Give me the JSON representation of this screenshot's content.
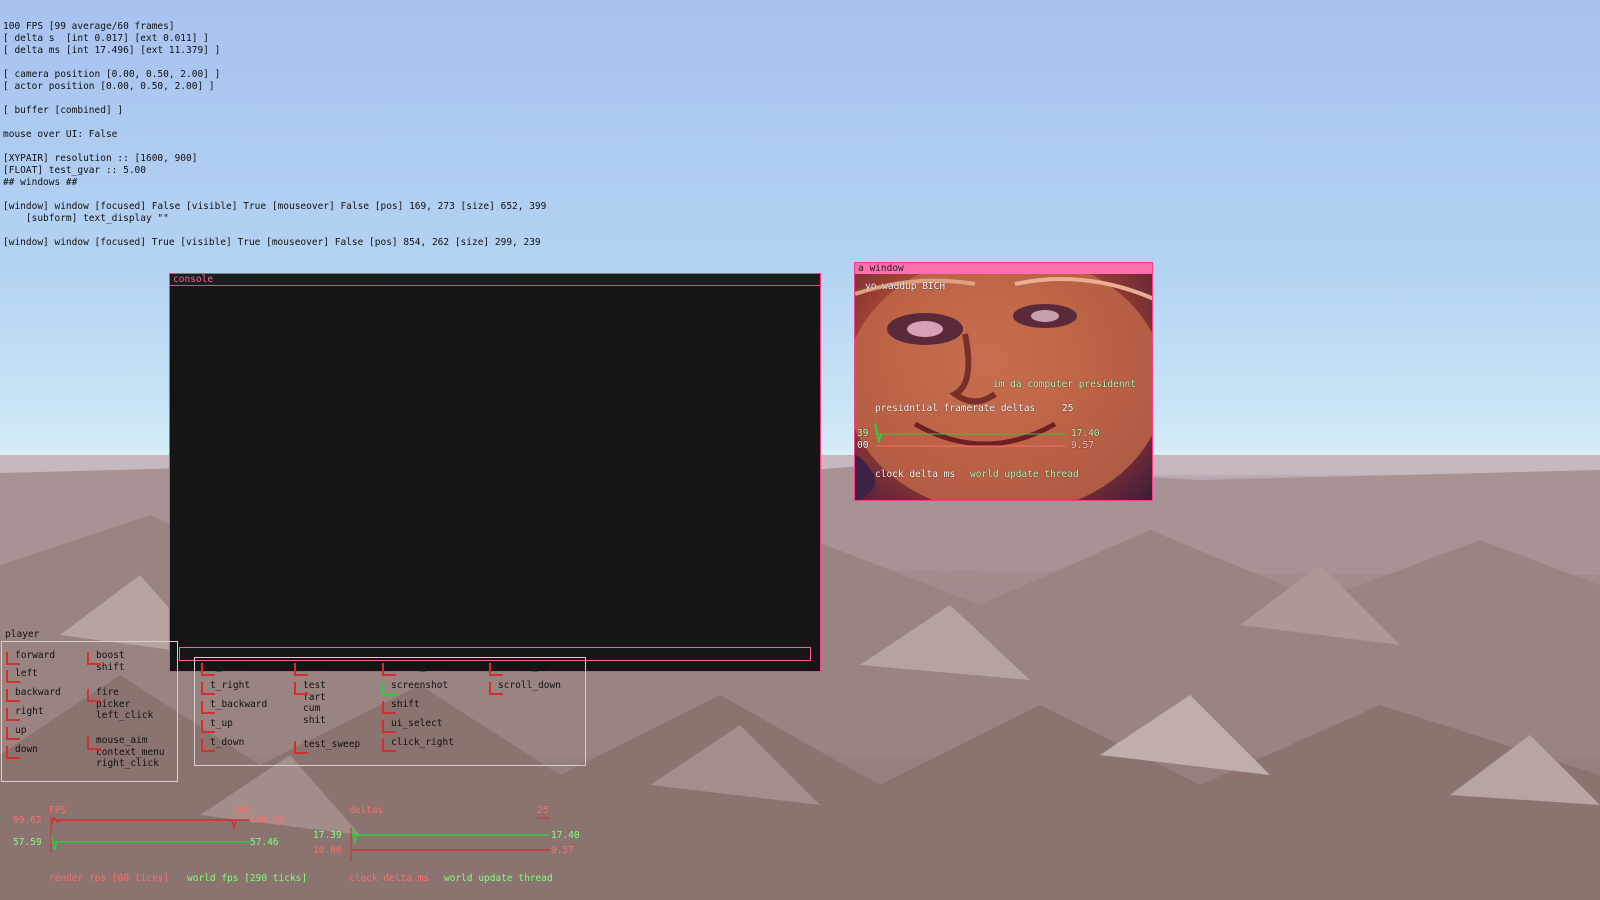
{
  "debug_lines": [
    "100 FPS [99 average/60 frames]",
    "[ delta s  [int 0.017] [ext 0.011] ]",
    "[ delta ms [int 17.496] [ext 11.379] ]",
    "",
    "[ camera position [0.00, 0.50, 2.00] ]",
    "[ actor position [0.00, 0.50, 2.00] ]",
    "",
    "[ buffer [combined] ]",
    "",
    "mouse over UI: False",
    "",
    "[XYPAIR] resolution :: [1600, 900]",
    "[FLOAT] test_gvar :: 5.00",
    "## windows ##",
    "",
    "[window] window [focused] False [visible] True [mouseover] False [pos] 169, 273 [size] 652, 399",
    "    [subform] text_display \"\"",
    "",
    "[window] window [focused] True [visible] True [mouseover] False [pos] 854, 262 [size] 299, 239"
  ],
  "console_window": {
    "title": "console",
    "input_value": ""
  },
  "image_window": {
    "title": "a window",
    "caption_top": "yo waddup BICH",
    "caption_mid": "im da computer presidennt",
    "graph_title": "presidntial framerate deltas",
    "graph_max": "25",
    "left_top": "39",
    "left_bottom": "00",
    "value_green": "17.40",
    "value_red": "9.57",
    "legend": [
      "clock delta ms",
      "world update thread"
    ]
  },
  "player_panel": {
    "label": "player",
    "col1": [
      {
        "label": "forward"
      },
      {
        "label": "left"
      },
      {
        "label": "backward"
      },
      {
        "label": "right"
      },
      {
        "label": "up"
      },
      {
        "label": "down"
      }
    ],
    "col2": [
      {
        "label": "boost\nshift"
      },
      {
        "label": "fire\npicker\nleft_click"
      },
      {
        "label": "mouse_aim\ncontext_menu\nright_click"
      }
    ]
  },
  "bindings_panel": {
    "col1": [
      "t_left",
      "t_right",
      "t_backward",
      "t_up",
      "t_down"
    ],
    "col2": [
      "down",
      "test\nfart\ncum\nshit",
      "test_sweep"
    ],
    "col3": [
      "poopy_butt",
      "screenshot",
      "shift",
      "ui_select",
      "click_right"
    ],
    "col4": [
      "scroll_up",
      "scroll_down"
    ]
  },
  "fps_graph": {
    "title": "FPS",
    "max_label": "100",
    "left_top": "99.62",
    "left_bottom": "57.59",
    "right_top": "100.00",
    "right_bottom": "57.46",
    "legend": [
      "render fps [60 ticks]",
      "world fps [290 ticks]"
    ]
  },
  "deltas_graph": {
    "title": "deltas",
    "max_label": "25",
    "left_top": "17.39",
    "left_bottom": "10.00",
    "right_top": "17.40",
    "right_bottom": "9.57",
    "legend": [
      "clock delta ms",
      "world update thread"
    ]
  },
  "colors": {
    "accent": "#ff3c8c",
    "graph_red": "#d32f2f",
    "graph_green": "#2ecc40",
    "console_bg": "#151515"
  }
}
